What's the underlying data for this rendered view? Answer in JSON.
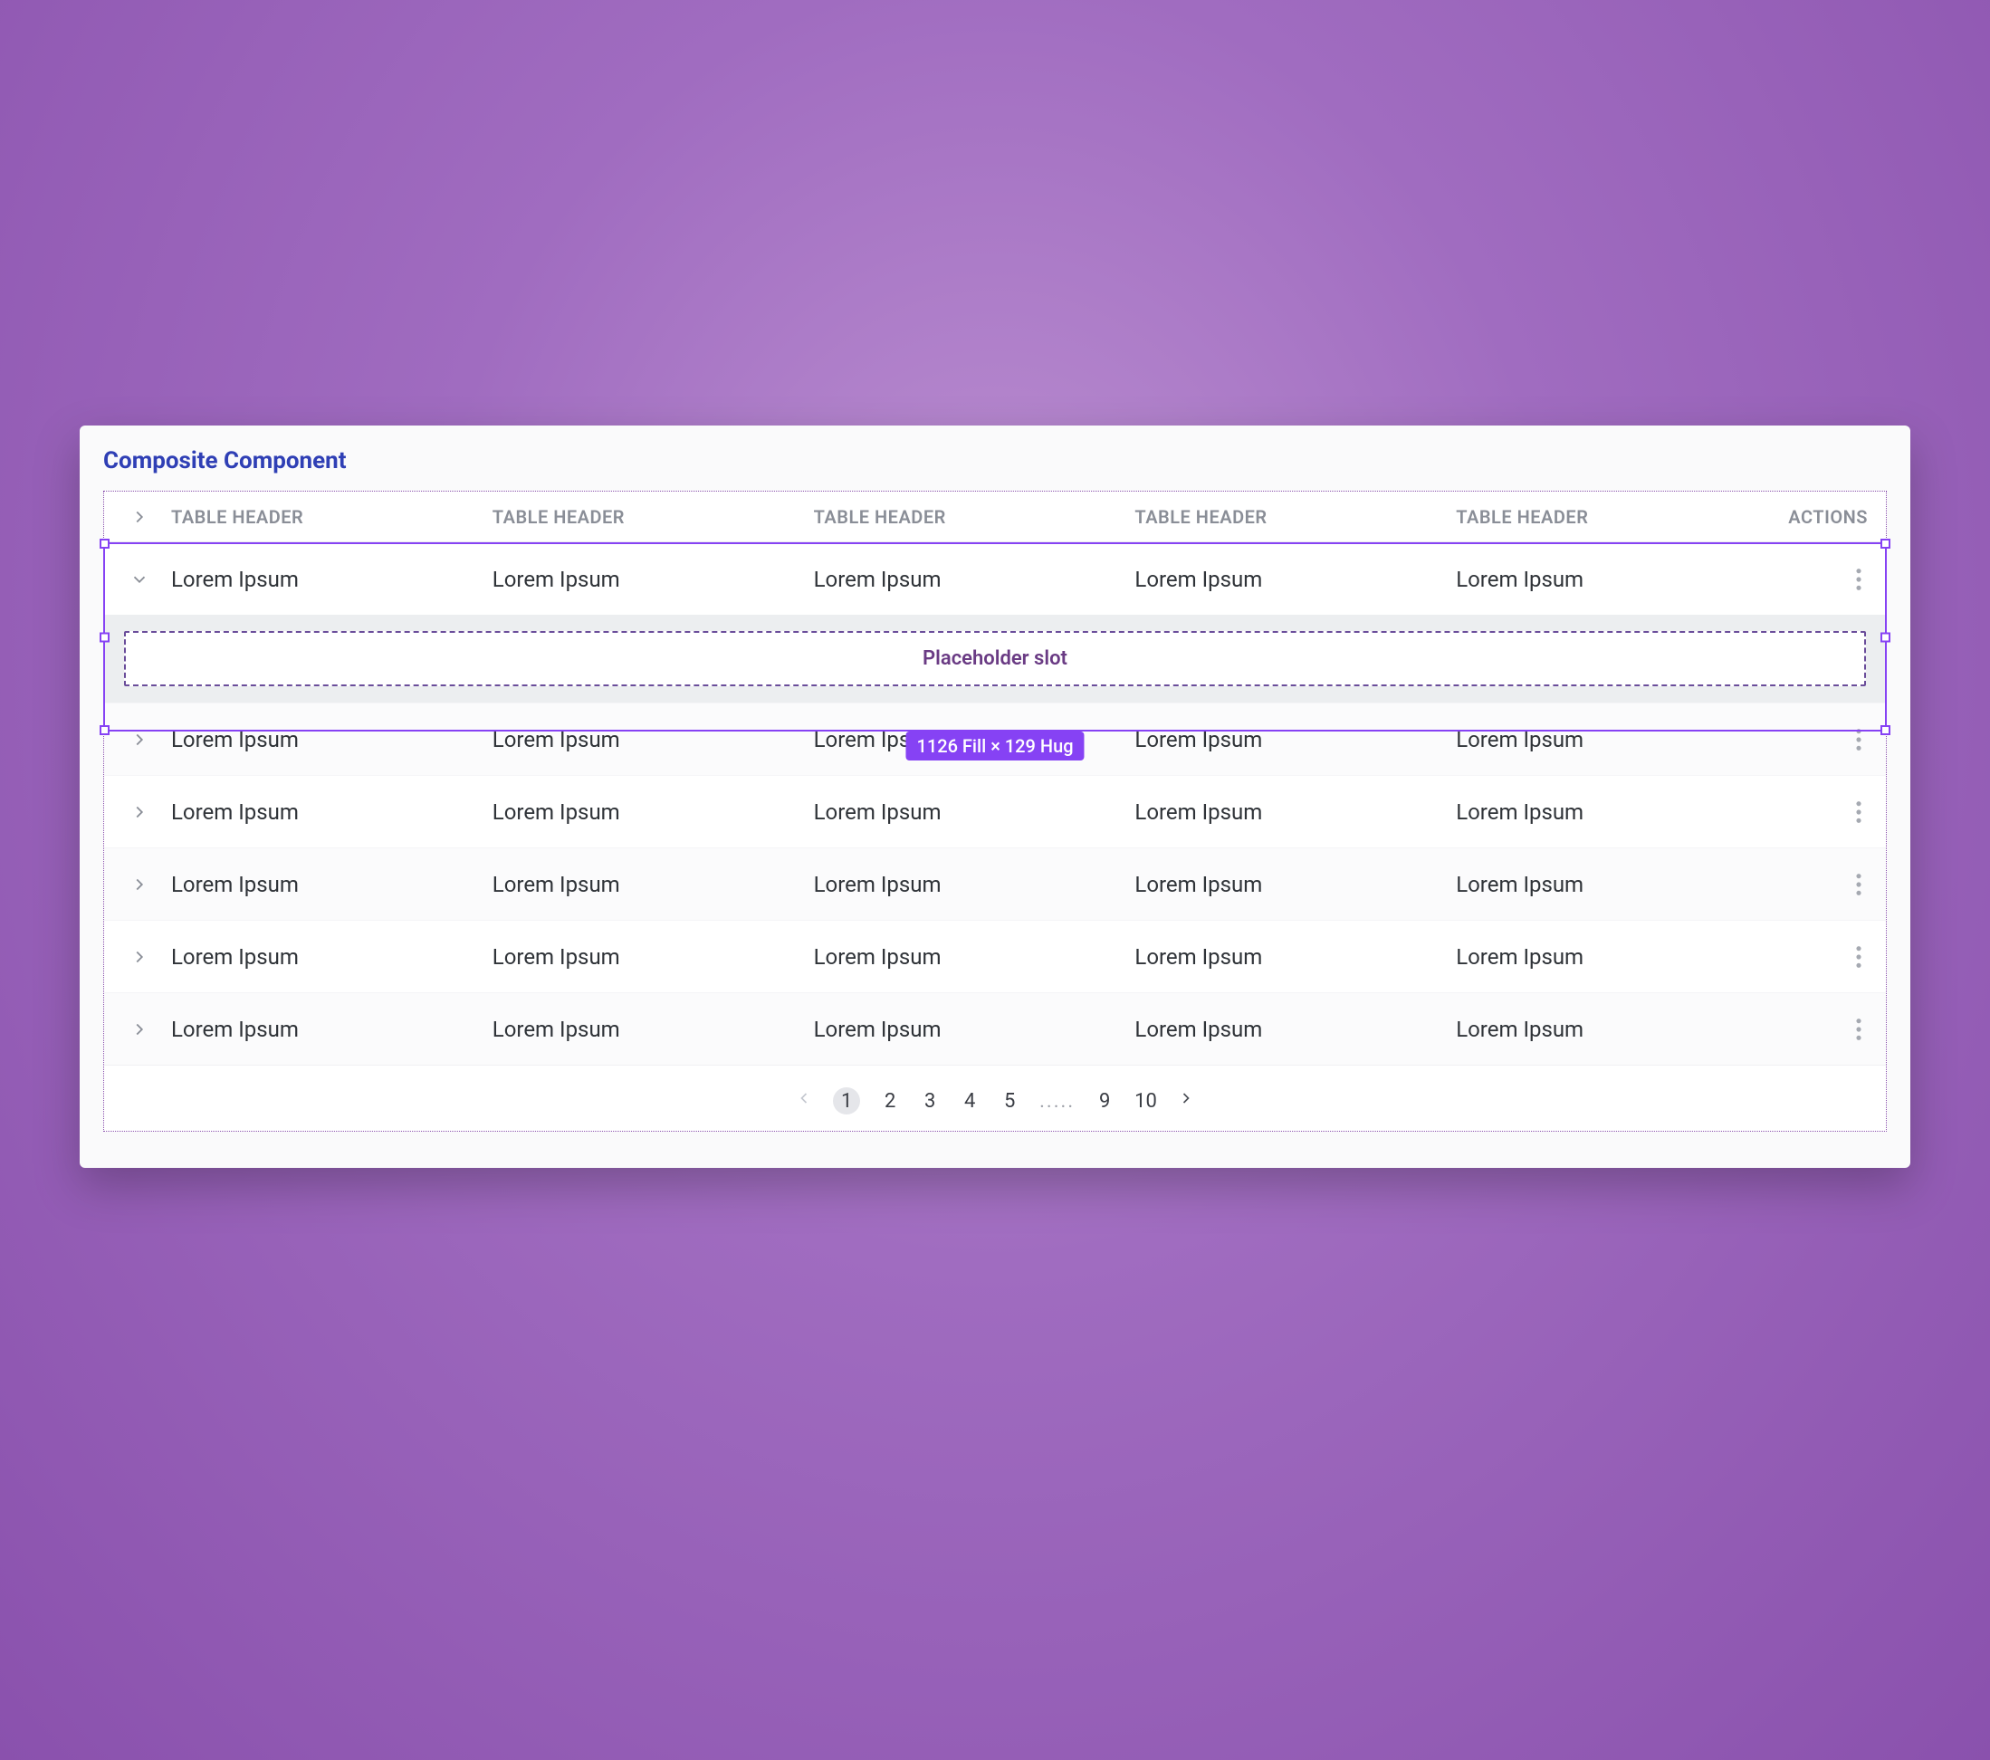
{
  "panel": {
    "title": "Composite Component"
  },
  "table": {
    "headers": [
      "TABLE HEADER",
      "TABLE HEADER",
      "TABLE HEADER",
      "TABLE HEADER",
      "TABLE HEADER"
    ],
    "actions_header": "ACTIONS",
    "rows": [
      {
        "expanded": true,
        "cells": [
          "Lorem Ipsum",
          "Lorem Ipsum",
          "Lorem Ipsum",
          "Lorem Ipsum",
          "Lorem Ipsum"
        ]
      },
      {
        "expanded": false,
        "cells": [
          "Lorem Ipsum",
          "Lorem Ipsum",
          "Lorem Ipsum",
          "Lorem Ipsum",
          "Lorem Ipsum"
        ]
      },
      {
        "expanded": false,
        "cells": [
          "Lorem Ipsum",
          "Lorem Ipsum",
          "Lorem Ipsum",
          "Lorem Ipsum",
          "Lorem Ipsum"
        ]
      },
      {
        "expanded": false,
        "cells": [
          "Lorem Ipsum",
          "Lorem Ipsum",
          "Lorem Ipsum",
          "Lorem Ipsum",
          "Lorem Ipsum"
        ]
      },
      {
        "expanded": false,
        "cells": [
          "Lorem Ipsum",
          "Lorem Ipsum",
          "Lorem Ipsum",
          "Lorem Ipsum",
          "Lorem Ipsum"
        ]
      },
      {
        "expanded": false,
        "cells": [
          "Lorem Ipsum",
          "Lorem Ipsum",
          "Lorem Ipsum",
          "Lorem Ipsum",
          "Lorem Ipsum"
        ]
      }
    ],
    "placeholder_label": "Placeholder slot"
  },
  "selection": {
    "size_label": "1126 Fill × 129 Hug"
  },
  "pagination": {
    "pages": [
      "1",
      "2",
      "3",
      "4",
      "5",
      ".....",
      "9",
      "10"
    ],
    "current": "1"
  }
}
